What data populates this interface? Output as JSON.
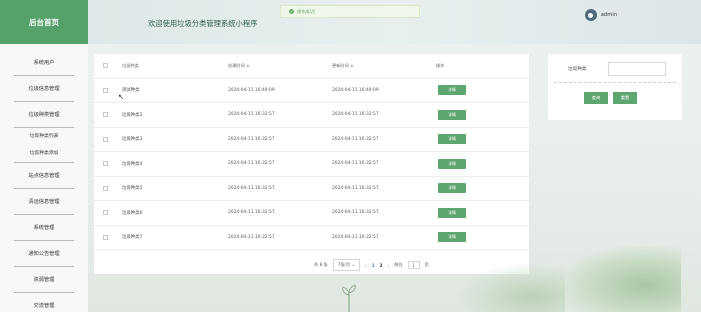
{
  "sidebar": {
    "logo": "后台首页",
    "items": [
      {
        "label": "系统用户",
        "type": "item"
      },
      {
        "label": "垃圾信息管理",
        "type": "item"
      },
      {
        "label": "垃圾种类管理",
        "type": "item"
      },
      {
        "label": "垃圾种类列表",
        "type": "sub"
      },
      {
        "label": "垃圾种类添加",
        "type": "sub-last"
      },
      {
        "label": "站点信息管理",
        "type": "item"
      },
      {
        "label": "清运信息管理",
        "type": "item"
      },
      {
        "label": "系统管理",
        "type": "item"
      },
      {
        "label": "通知公告管理",
        "type": "item"
      },
      {
        "label": "资源管理",
        "type": "item"
      },
      {
        "label": "交流管理",
        "type": "item"
      }
    ]
  },
  "header": {
    "welcome": "欢迎使用垃圾分类管理系统小程序",
    "toast": "操作成功!",
    "toast_icon": "check-icon",
    "username": "admin"
  },
  "table": {
    "columns": [
      "垃圾种类",
      "创建时间 ≑",
      "更新时间 ≑",
      "操作"
    ],
    "detail_label": "详情",
    "rows": [
      {
        "name": "测试种类",
        "created": "2024-04-11 16:49:09",
        "updated": "2024-04-11 16:49:09"
      },
      {
        "name": "垃圾种类2",
        "created": "2024-04-11 16:32:57",
        "updated": "2024-04-11 16:32:57"
      },
      {
        "name": "垃圾种类3",
        "created": "2024-04-11 16:32:57",
        "updated": "2024-04-11 16:32:57"
      },
      {
        "name": "垃圾种类4",
        "created": "2024-04-11 16:32:57",
        "updated": "2024-04-11 16:32:57"
      },
      {
        "name": "垃圾种类5",
        "created": "2024-04-11 16:32:57",
        "updated": "2024-04-11 16:32:57"
      },
      {
        "name": "垃圾种类6",
        "created": "2024-04-11 16:32:57",
        "updated": "2024-04-11 16:32:57"
      },
      {
        "name": "垃圾种类7",
        "created": "2024-04-11 16:32:57",
        "updated": "2024-04-11 16:32:57"
      }
    ]
  },
  "pagination": {
    "total": "共 8 条",
    "page_size": "7条/页",
    "prev": "‹",
    "pages": [
      "1",
      "2"
    ],
    "current": "1",
    "next": "›",
    "goto_label": "前往",
    "goto_value": "1",
    "page_unit": "页"
  },
  "search": {
    "label": "垃圾种类",
    "value": "",
    "query_button": "查询",
    "reset_button": "重置"
  },
  "colors": {
    "accent": "#5ea66f",
    "logo_bg": "#56a06a"
  }
}
